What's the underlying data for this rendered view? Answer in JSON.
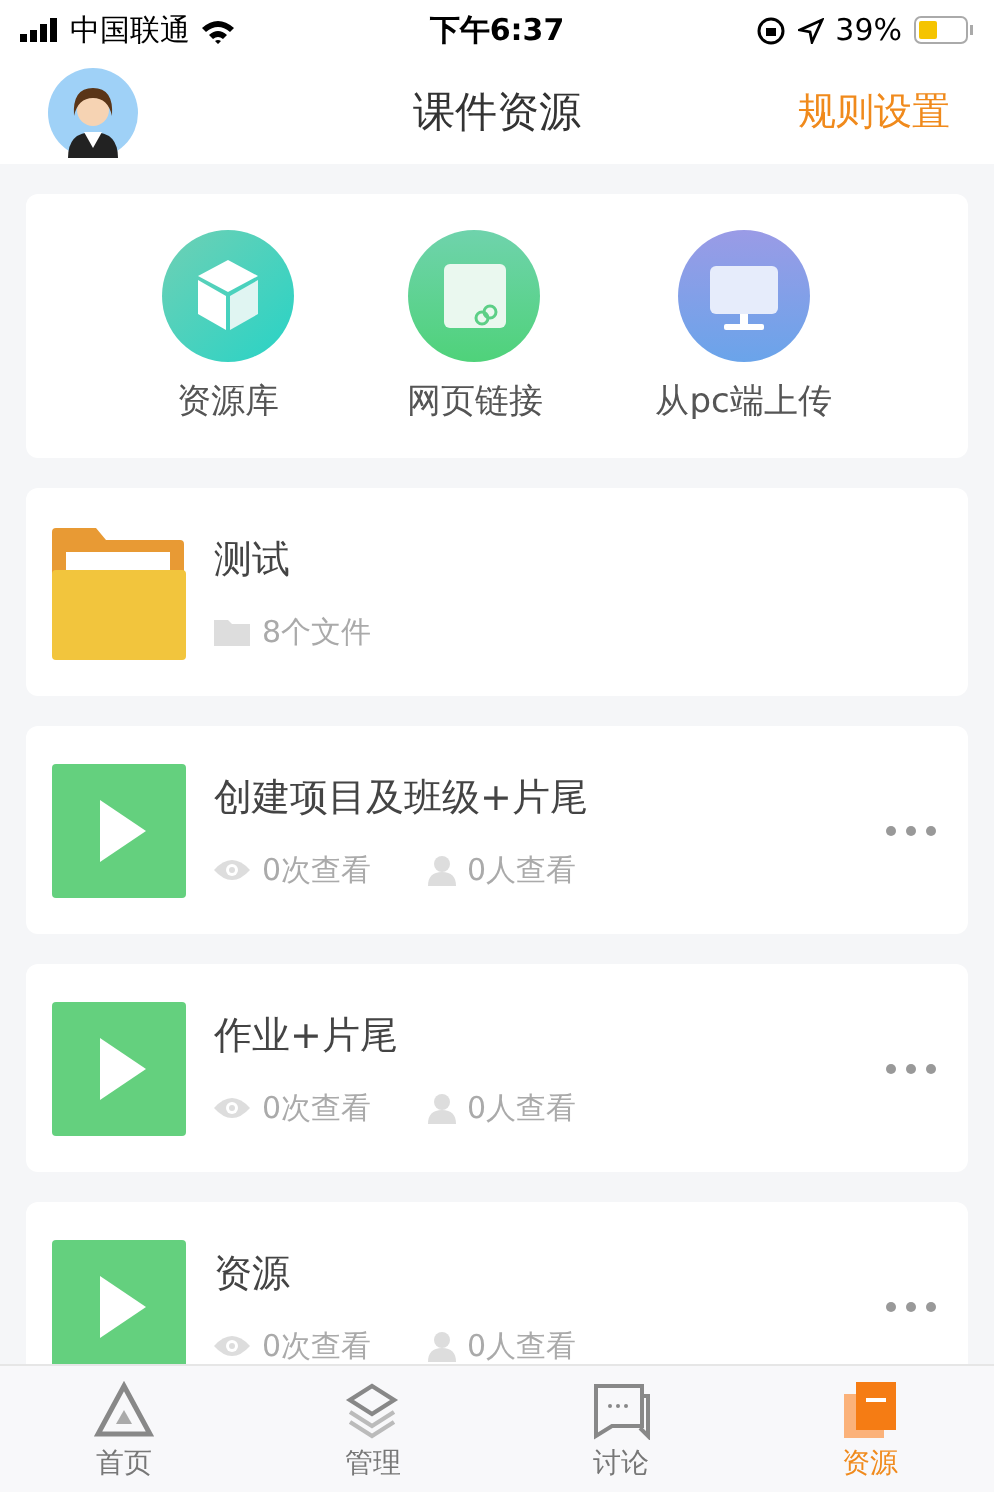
{
  "status_bar": {
    "carrier": "中国联通",
    "time": "下午6:37",
    "battery": "39%"
  },
  "header": {
    "title": "课件资源",
    "action": "规则设置"
  },
  "quick_actions": [
    {
      "label": "资源库",
      "kind": "box"
    },
    {
      "label": "网页链接",
      "kind": "link"
    },
    {
      "label": "从pc端上传",
      "kind": "monitor"
    }
  ],
  "items": [
    {
      "kind": "folder",
      "title": "测试",
      "count": "8个文件"
    },
    {
      "kind": "video",
      "title": "创建项目及班级+片尾",
      "views": "0次查看",
      "viewers": "0人查看"
    },
    {
      "kind": "video",
      "title": "作业+片尾",
      "views": "0次查看",
      "viewers": "0人查看"
    },
    {
      "kind": "video",
      "title": "资源",
      "views": "0次查看",
      "viewers": "0人查看"
    }
  ],
  "tabs": [
    {
      "label": "首页",
      "kind": "home",
      "selected": false
    },
    {
      "label": "管理",
      "kind": "layers",
      "selected": false
    },
    {
      "label": "讨论",
      "kind": "chat",
      "selected": false
    },
    {
      "label": "资源",
      "kind": "resource",
      "selected": true
    }
  ]
}
